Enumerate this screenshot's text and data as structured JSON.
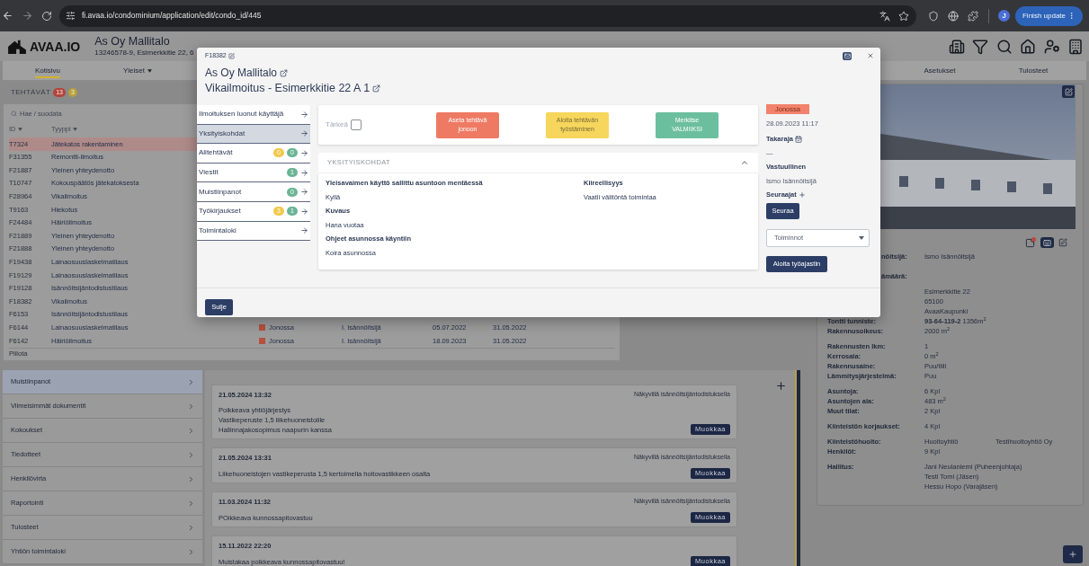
{
  "browser": {
    "url": "fi.avaa.io/condominium/application/edit/condo_id/445",
    "profile_initial": "J",
    "update_button": "Finish update"
  },
  "header": {
    "logo": "AVAA.IO",
    "title": "As Oy Mallitalo",
    "subtitle": "13246578-9, Esimerkkitie 22, 6"
  },
  "nav": [
    {
      "label": "Kotisivu",
      "selected": true,
      "dropdown": false
    },
    {
      "label": "Yleiset",
      "selected": false,
      "dropdown": true
    },
    {
      "label": "Asetukset",
      "selected": false,
      "dropdown": false
    },
    {
      "label": "Tulosteet",
      "selected": false,
      "dropdown": false
    }
  ],
  "tasks": {
    "title": "TEHTÄVÄT",
    "badges": [
      {
        "text": "13",
        "color": "#b3443a"
      },
      {
        "text": "3",
        "color": "#b8a13a"
      }
    ],
    "search": {
      "placeholder": "Hae / suodata"
    },
    "columns": [
      "ID",
      "Tyyppi"
    ],
    "rows": [
      {
        "id": "T7324",
        "type": "Jätekatos rakentaminen",
        "highlighted": true
      },
      {
        "id": "F31355",
        "type": "Remontti-ilmoitus",
        "highlighted": false
      },
      {
        "id": "F21887",
        "type": "Yleinen yhteydenotto",
        "highlighted": false
      },
      {
        "id": "T10747",
        "type": "Kokouspäätös jätekatoksesta",
        "highlighted": false
      },
      {
        "id": "F28964",
        "type": "Vikailmoitus",
        "highlighted": false
      },
      {
        "id": "T9163",
        "type": "Hiekotus",
        "highlighted": false
      },
      {
        "id": "F24484",
        "type": "Häiriöilmoitus",
        "highlighted": false
      },
      {
        "id": "F21889",
        "type": "Yleinen yhteydenotto",
        "highlighted": false
      },
      {
        "id": "F21888",
        "type": "Yleinen yhteydenotto",
        "highlighted": false
      },
      {
        "id": "F19438",
        "type": "Lainaosuuslaskelmatilaus",
        "highlighted": false
      },
      {
        "id": "F19129",
        "type": "Lainaosuuslaskelmatilaus",
        "highlighted": false
      },
      {
        "id": "F19128",
        "type": "Isännöitsijäntodistustilaus",
        "highlighted": false
      },
      {
        "id": "F18382",
        "type": "Vikailmoitus",
        "highlighted": false
      },
      {
        "id": "F6153",
        "type": "Isännöitsijäntodistustilaus",
        "highlighted": false
      },
      {
        "id": "F6144",
        "type": "Lainaosuuslaskelmatilaus",
        "highlighted": false,
        "status": {
          "label": "Jonossa",
          "color": "#b4513f"
        },
        "assignee": "I. Isännöitsijä",
        "date_1": "05.07.2022",
        "date_2": "31.05.2022"
      },
      {
        "id": "F6142",
        "type": "Häiriöilmoitus",
        "highlighted": false,
        "status": {
          "label": "Jonossa",
          "color": "#b4513f"
        },
        "assignee": "I. Isännöitsijä",
        "date_1": "18.09.2023",
        "date_2": "31.05.2022"
      }
    ],
    "hide_link": "Piilota"
  },
  "modal": {
    "id": "F18382",
    "title": "As Oy Mallitalo",
    "subtitle": "Vikailmoitus - Esimerkkitie 22 A 1",
    "menu": [
      {
        "label": "Ilmoituksen luonut käyttäjä",
        "selected": false
      },
      {
        "label": "Yksityiskohdat",
        "selected": true
      },
      {
        "label": "Alitehtävät",
        "selected": false,
        "badges": [
          {
            "text": "0",
            "color": "#f2c94c"
          },
          {
            "text": "0",
            "color": "#6bb596"
          }
        ]
      },
      {
        "label": "Viestit",
        "selected": false,
        "badges": [
          {
            "text": "1",
            "color": "#6bb596"
          }
        ]
      },
      {
        "label": "Muistiinpanot",
        "selected": false,
        "badges": [
          {
            "text": "0",
            "color": "#6bb596"
          }
        ]
      },
      {
        "label": "Työkirjaukset",
        "selected": false,
        "badges": [
          {
            "text": "3",
            "color": "#f2c94c"
          },
          {
            "text": "1",
            "color": "#6bb596"
          }
        ]
      },
      {
        "label": "Toimintaloki",
        "selected": false
      }
    ],
    "important": {
      "label": "Tärkeä",
      "checked": false
    },
    "actions": [
      {
        "label": "Aseta tehtävä jonoon",
        "color": "#ee7a63"
      },
      {
        "label": "Aloita tehtävän työstäminen",
        "color": "#f6d65c"
      },
      {
        "label": "Merkitse VALMIIKSI",
        "color": "#6cbf9e"
      }
    ],
    "section": {
      "title": "YKSITYISKOHDAT",
      "expanded": true,
      "columns": [
        [
          {
            "label": "Yleisavaimen käyttö sallittu asuntoon mentäessä",
            "value": "Kyllä"
          },
          {
            "label": "Kuvaus",
            "value": "Hana vuotaa"
          },
          {
            "label": "Ohjeet asunnossa käyntiin",
            "value": "Koira asunnossa"
          }
        ],
        [
          {
            "label": "Kiireellisyys",
            "value": "Vaatii välitöntä toimintaa"
          }
        ]
      ]
    },
    "side": {
      "status": {
        "label": "Jonossa",
        "color": "#f2826b"
      },
      "created": "28.09.2023 11:17",
      "deadline_label": "Takaraja",
      "deadline": "—",
      "responsible_label": "Vastuullinen",
      "responsible": "Ismo Isännöitsijä",
      "followers_label": "Seuraajat",
      "follow_button": "Seuraa",
      "actions_select": {
        "value": "Toiminnot"
      },
      "timer_button": "Aloita työajastin"
    },
    "close_button": "Sulje"
  },
  "notes_menu": [
    {
      "label": "Muistiinpanot",
      "selected": true
    },
    {
      "label": "Viimeisimmät dokumentit",
      "selected": false
    },
    {
      "label": "Kokoukset",
      "selected": false
    },
    {
      "label": "Tiedotteet",
      "selected": false
    },
    {
      "label": "Henkilövirta",
      "selected": false
    },
    {
      "label": "Raportointi",
      "selected": false
    },
    {
      "label": "Tulosteet",
      "selected": false
    },
    {
      "label": "Yhtiön toimintaloki",
      "selected": false
    }
  ],
  "notes": [
    {
      "date": "21.05.2024 13:32",
      "visibility": "Näkyvillä isännöitsijäntodistuksella",
      "lines": [
        "Poikkeava yhtiöjärjestys",
        "Vastikeperuste 1,5 liikehuoneistoille",
        "Hallinnajakosopimus naapurin kanssa"
      ],
      "edit_button": "Muokkaa"
    },
    {
      "date": "21.05.2024 13:31",
      "visibility": "Näkyvillä isännöitsijäntodistuksella",
      "lines": [
        "Liikehuoneistojen vastikeperusta 1,5 kertoimella hoitovastikkeen osalta"
      ],
      "edit_button": "Muokkaa"
    },
    {
      "date": "11.03.2024 11:32",
      "visibility": "Näkyvillä isännöitsijäntodistuksella",
      "lines": [
        "POikkeava kunnossapitovastuu"
      ],
      "edit_button": "Muokkaa"
    },
    {
      "date": "15.11.2022 22:20",
      "lines": [
        "Muistakaa poikkeava kunnossapitovastuu!"
      ],
      "edit_button": "Muokkaa"
    }
  ],
  "property": {
    "partial_rows": [
      {
        "label": "nöitsijä:",
        "values": [
          "Ismo Isännöitsijä"
        ]
      },
      {
        "label": "ämäärä:"
      }
    ],
    "address": [
      "Esimerkkitie 22",
      "65100",
      "AvaaKaupunki"
    ],
    "groups": [
      [
        {
          "label": "Tontti tunniste:",
          "values": [
            "**93-64-119-2** 1356m$^{2}$"
          ]
        },
        {
          "label": "Rakennusoikeus:",
          "values": [
            "2000 m$^{2}$"
          ]
        }
      ],
      [
        {
          "label": "Rakennusten lkm:",
          "values": [
            "1"
          ]
        },
        {
          "label": "Kerrosala:",
          "values": [
            "0 m$^{2}$"
          ]
        },
        {
          "label": "Rakennusaine:",
          "values": [
            "Puu/tiili"
          ]
        },
        {
          "label": "Lämmitysjärjestelmä:",
          "values": [
            "Puu"
          ]
        }
      ],
      [
        {
          "label": "Asuntoja:",
          "values": [
            "6 Kpl"
          ]
        },
        {
          "label": "Asuntojen ala:",
          "values": [
            "483 m$^{2}$"
          ]
        },
        {
          "label": "Muut tilat:",
          "values": [
            "2 Kpl"
          ]
        }
      ],
      [
        {
          "label": "Kiinteistön korjaukset:",
          "values": [
            "4 Kpl"
          ]
        }
      ],
      [
        {
          "label": "Kiinteistöhuolto:",
          "values": [
            "Huoltoyhtiö"
          ],
          "company": "Testihuoltoyhtiö Oy"
        },
        {
          "label": "Henkilöt:",
          "values": [
            "9 Kpl"
          ]
        }
      ],
      [
        {
          "label": "Hallitus:",
          "values": [
            "Jani Neulaniemi (Puheenjohtaja)",
            "Testi Tomi (Jäsen)",
            "Hessu Hopo (Varajäsen)"
          ]
        }
      ]
    ]
  }
}
